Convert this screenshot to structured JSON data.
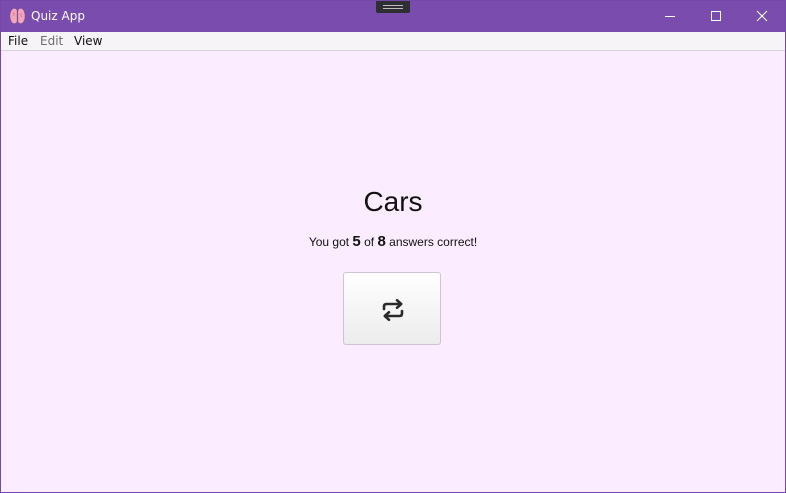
{
  "window": {
    "title": "Quiz App",
    "app_icon": "brain-icon",
    "controls": [
      "minimize-icon",
      "maximize-icon",
      "close-icon"
    ],
    "accent_color": "#7a4cae",
    "background_color": "#fbedff"
  },
  "menu": {
    "file": "File",
    "edit": "Edit",
    "view": "View"
  },
  "quiz": {
    "title": "Cars",
    "result_prefix": "You got",
    "correct": "5",
    "result_middle": "of",
    "total": "8",
    "result_suffix": "answers correct!",
    "retry_icon": "repeat-icon"
  }
}
